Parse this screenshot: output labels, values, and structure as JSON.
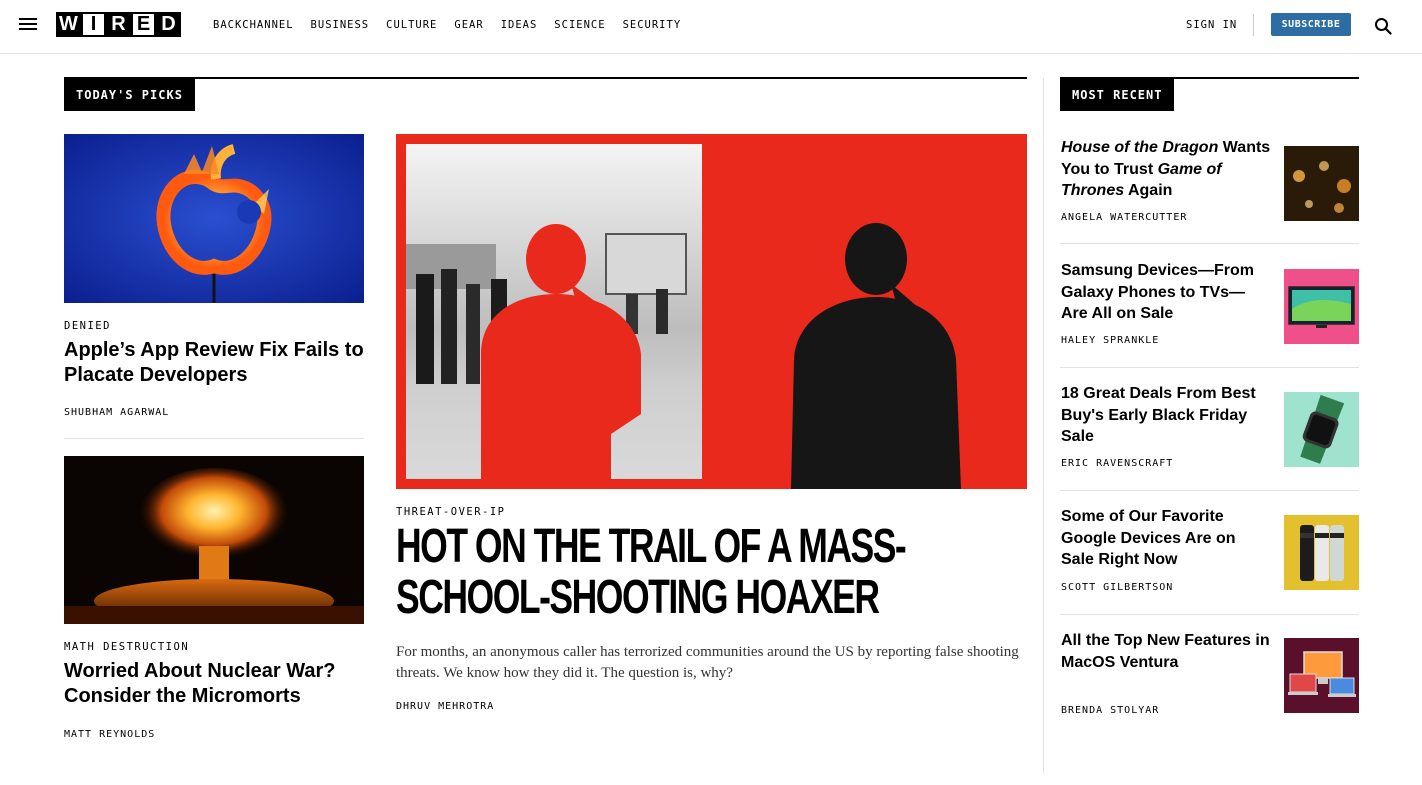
{
  "header": {
    "logo": [
      "W",
      "I",
      "R",
      "E",
      "D"
    ],
    "nav": [
      "BACKCHANNEL",
      "BUSINESS",
      "CULTURE",
      "GEAR",
      "IDEAS",
      "SCIENCE",
      "SECURITY"
    ],
    "sign_in": "SIGN IN",
    "subscribe": "SUBSCRIBE"
  },
  "todays_picks": {
    "label": "TODAY'S PICKS",
    "left_stories": [
      {
        "kicker": "DENIED",
        "headline": "Apple’s App Review Fix Fails to Placate Developers",
        "byline": "SHUBHAM AGARWAL",
        "image": "burning-apple-logo"
      },
      {
        "kicker": "MATH DESTRUCTION",
        "headline": "Worried About Nuclear War? Consider the Micromorts",
        "byline": "MATT REYNOLDS",
        "image": "nuclear-explosion"
      }
    ],
    "feature": {
      "kicker": "THREAT-OVER-IP",
      "headline": "HOT ON THE TRAIL OF A MASS-SCHOOL-SHOOTING HOAXER",
      "dek": "For months, an anonymous caller has terrorized communities around the US by reporting false shooting threats. We know how they did it. The question is, why?",
      "byline": "DHRUV MEHROTRA",
      "image": "red-silhouettes-on-phone",
      "colors": {
        "red": "#e8291c"
      }
    }
  },
  "most_recent": {
    "label": "MOST RECENT",
    "items": [
      {
        "headline_parts": [
          {
            "text": "House of the Dragon",
            "italic": true
          },
          {
            "text": " Wants You to Trust ",
            "italic": false
          },
          {
            "text": "Game of Thrones",
            "italic": true
          },
          {
            "text": " Again",
            "italic": false
          }
        ],
        "byline": "ANGELA WATERCUTTER",
        "thumb": "candlelit-scene"
      },
      {
        "headline_parts": [
          {
            "text": "Samsung Devices—From Galaxy Phones to TVs—Are All on Sale",
            "italic": false
          }
        ],
        "byline": "HALEY SPRANKLE",
        "thumb": "samsung-tv-on-pink"
      },
      {
        "headline_parts": [
          {
            "text": "18 Great Deals From Best Buy's Early Black Friday Sale",
            "italic": false
          }
        ],
        "byline": "ERIC RAVENSCRAFT",
        "thumb": "green-smartwatch"
      },
      {
        "headline_parts": [
          {
            "text": "Some of Our Favorite Google Devices Are on Sale Right Now",
            "italic": false
          }
        ],
        "byline": "SCOTT GILBERTSON",
        "thumb": "pixel-phones-on-yellow"
      },
      {
        "headline_parts": [
          {
            "text": "All the Top New Features in MacOS Ventura",
            "italic": false
          }
        ],
        "byline": "BRENDA STOLYAR",
        "thumb": "macos-devices"
      }
    ]
  }
}
